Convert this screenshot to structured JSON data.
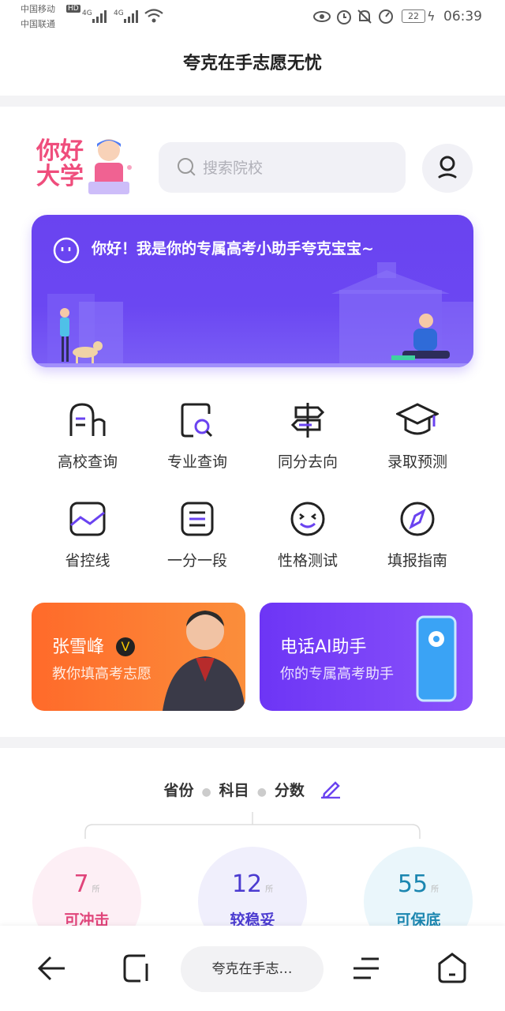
{
  "status_bar": {
    "carrier1": "中国移动",
    "carrier2": "中国联通",
    "network1": "4G",
    "network2": "4G",
    "battery": "22",
    "time": "06:39"
  },
  "header": {
    "title": "夸克在手志愿无忧"
  },
  "logo": {
    "text_line1": "你好",
    "text_line2": "大学"
  },
  "search": {
    "placeholder": "搜索院校"
  },
  "banner": {
    "text": "你好！我是你的专属高考小助手夸克宝宝~"
  },
  "grid": [
    {
      "label": "高校查询",
      "icon": "school-icon"
    },
    {
      "label": "专业查询",
      "icon": "major-search-icon"
    },
    {
      "label": "同分去向",
      "icon": "signpost-icon"
    },
    {
      "label": "录取预测",
      "icon": "graduation-cap-icon"
    },
    {
      "label": "省控线",
      "icon": "chart-line-icon"
    },
    {
      "label": "一分一段",
      "icon": "list-icon"
    },
    {
      "label": "性格测试",
      "icon": "smiley-icon"
    },
    {
      "label": "填报指南",
      "icon": "compass-icon"
    }
  ],
  "cards": {
    "left": {
      "title": "张雪峰",
      "subtitle": "教你填高考志愿",
      "badge": "V"
    },
    "right": {
      "title": "电话AI助手",
      "subtitle": "你的专属高考助手"
    }
  },
  "filters": {
    "province": "省份",
    "subject": "科目",
    "score": "分数"
  },
  "results": [
    {
      "count": "7",
      "unit": "所",
      "label": "可冲击",
      "color": "#e0447a",
      "bg": "#fdeff5"
    },
    {
      "count": "12",
      "unit": "所",
      "label": "较稳妥",
      "color": "#4b3bd0",
      "bg": "#f0effc"
    },
    {
      "count": "55",
      "unit": "所",
      "label": "可保底",
      "color": "#1b86b0",
      "bg": "#eaf6fb"
    }
  ],
  "bottom_nav": {
    "tab_title": "夸克在手志…"
  }
}
